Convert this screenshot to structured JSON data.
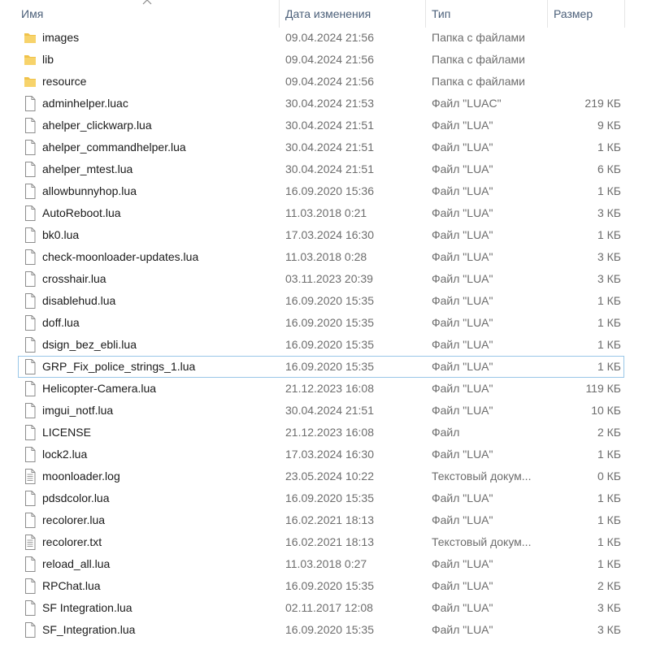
{
  "columns": {
    "name": "Имя",
    "date": "Дата изменения",
    "type": "Тип",
    "size": "Размер",
    "sort_indicator": "chevron-up-icon"
  },
  "colors": {
    "folder": "#f0c24a",
    "focus_border": "#99c7e8",
    "header_text": "#4c607a"
  },
  "files": [
    {
      "name": "images",
      "date": "09.04.2024 21:56",
      "type": "Папка с файлами",
      "size": "",
      "icon": "folder"
    },
    {
      "name": "lib",
      "date": "09.04.2024 21:56",
      "type": "Папка с файлами",
      "size": "",
      "icon": "folder"
    },
    {
      "name": "resource",
      "date": "09.04.2024 21:56",
      "type": "Папка с файлами",
      "size": "",
      "icon": "folder"
    },
    {
      "name": "adminhelper.luac",
      "date": "30.04.2024 21:53",
      "type": "Файл \"LUAC\"",
      "size": "219 КБ",
      "icon": "file"
    },
    {
      "name": "ahelper_clickwarp.lua",
      "date": "30.04.2024 21:51",
      "type": "Файл \"LUA\"",
      "size": "9 КБ",
      "icon": "file"
    },
    {
      "name": "ahelper_commandhelper.lua",
      "date": "30.04.2024 21:51",
      "type": "Файл \"LUA\"",
      "size": "1 КБ",
      "icon": "file"
    },
    {
      "name": "ahelper_mtest.lua",
      "date": "30.04.2024 21:51",
      "type": "Файл \"LUA\"",
      "size": "6 КБ",
      "icon": "file"
    },
    {
      "name": "allowbunnyhop.lua",
      "date": "16.09.2020 15:36",
      "type": "Файл \"LUA\"",
      "size": "1 КБ",
      "icon": "file"
    },
    {
      "name": "AutoReboot.lua",
      "date": "11.03.2018 0:21",
      "type": "Файл \"LUA\"",
      "size": "3 КБ",
      "icon": "file"
    },
    {
      "name": "bk0.lua",
      "date": "17.03.2024 16:30",
      "type": "Файл \"LUA\"",
      "size": "1 КБ",
      "icon": "file"
    },
    {
      "name": "check-moonloader-updates.lua",
      "date": "11.03.2018 0:28",
      "type": "Файл \"LUA\"",
      "size": "3 КБ",
      "icon": "file"
    },
    {
      "name": "crosshair.lua",
      "date": "03.11.2023 20:39",
      "type": "Файл \"LUA\"",
      "size": "3 КБ",
      "icon": "file"
    },
    {
      "name": "disablehud.lua",
      "date": "16.09.2020 15:35",
      "type": "Файл \"LUA\"",
      "size": "1 КБ",
      "icon": "file"
    },
    {
      "name": "doff.lua",
      "date": "16.09.2020 15:35",
      "type": "Файл \"LUA\"",
      "size": "1 КБ",
      "icon": "file"
    },
    {
      "name": "dsign_bez_ebli.lua",
      "date": "16.09.2020 15:35",
      "type": "Файл \"LUA\"",
      "size": "1 КБ",
      "icon": "file"
    },
    {
      "name": "GRP_Fix_police_strings_1.lua",
      "date": "16.09.2020 15:35",
      "type": "Файл \"LUA\"",
      "size": "1 КБ",
      "icon": "file",
      "focused": true
    },
    {
      "name": "Helicopter-Camera.lua",
      "date": "21.12.2023 16:08",
      "type": "Файл \"LUA\"",
      "size": "119 КБ",
      "icon": "file"
    },
    {
      "name": "imgui_notf.lua",
      "date": "30.04.2024 21:51",
      "type": "Файл \"LUA\"",
      "size": "10 КБ",
      "icon": "file"
    },
    {
      "name": "LICENSE",
      "date": "21.12.2023 16:08",
      "type": "Файл",
      "size": "2 КБ",
      "icon": "file"
    },
    {
      "name": "lock2.lua",
      "date": "17.03.2024 16:30",
      "type": "Файл \"LUA\"",
      "size": "1 КБ",
      "icon": "file"
    },
    {
      "name": "moonloader.log",
      "date": "23.05.2024 10:22",
      "type": "Текстовый докум...",
      "size": "0 КБ",
      "icon": "text"
    },
    {
      "name": "pdsdcolor.lua",
      "date": "16.09.2020 15:35",
      "type": "Файл \"LUA\"",
      "size": "1 КБ",
      "icon": "file"
    },
    {
      "name": "recolorer.lua",
      "date": "16.02.2021 18:13",
      "type": "Файл \"LUA\"",
      "size": "1 КБ",
      "icon": "file"
    },
    {
      "name": "recolorer.txt",
      "date": "16.02.2021 18:13",
      "type": "Текстовый докум...",
      "size": "1 КБ",
      "icon": "text"
    },
    {
      "name": "reload_all.lua",
      "date": "11.03.2018 0:27",
      "type": "Файл \"LUA\"",
      "size": "1 КБ",
      "icon": "file"
    },
    {
      "name": "RPChat.lua",
      "date": "16.09.2020 15:35",
      "type": "Файл \"LUA\"",
      "size": "2 КБ",
      "icon": "file"
    },
    {
      "name": "SF Integration.lua",
      "date": "02.11.2017 12:08",
      "type": "Файл \"LUA\"",
      "size": "3 КБ",
      "icon": "file"
    },
    {
      "name": "SF_Integration.lua",
      "date": "16.09.2020 15:35",
      "type": "Файл \"LUA\"",
      "size": "3 КБ",
      "icon": "file"
    }
  ]
}
